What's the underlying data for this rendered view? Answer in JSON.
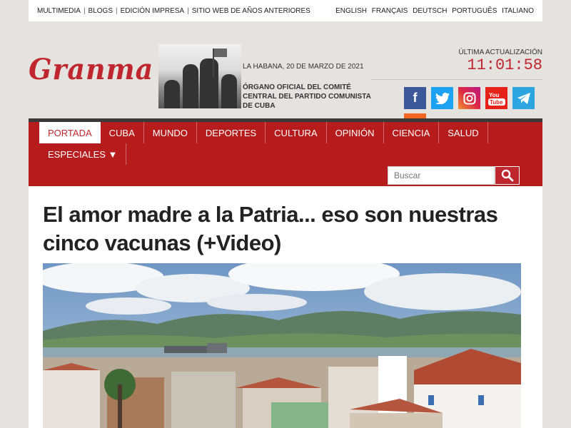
{
  "topbar": {
    "links": [
      "MULTIMEDIA",
      "BLOGS",
      "EDICIÓN IMPRESA",
      "SITIO WEB DE AÑOS ANTERIORES"
    ],
    "languages": [
      "ENGLISH",
      "FRANÇAIS",
      "DEUTSCH",
      "PORTUGUÊS",
      "ITALIANO"
    ]
  },
  "header": {
    "logo": "Granma",
    "date": "LA HABANA, 20 DE MARZO DE 2021",
    "organ": "ÓRGANO OFICIAL DEL COMITÉ CENTRAL DEL PARTIDO COMUNISTA DE CUBA",
    "update_label": "ÚLTIMA ACTUALIZACIÓN",
    "update_time": "11:01:58"
  },
  "social": [
    "facebook-icon",
    "twitter-icon",
    "instagram-icon",
    "youtube-icon",
    "telegram-icon",
    "rss-icon"
  ],
  "nav": {
    "items": [
      "PORTADA",
      "CUBA",
      "MUNDO",
      "DEPORTES",
      "CULTURA",
      "OPINIÓN",
      "CIENCIA",
      "SALUD"
    ],
    "especiales": "ESPECIALES ▼",
    "search_placeholder": "Buscar"
  },
  "article": {
    "title": "El amor madre a la Patria... eso son nuestras cinco vacunas (+Video)"
  },
  "colors": {
    "brand_red": "#c0262d",
    "nav_red": "#b71c1c"
  }
}
